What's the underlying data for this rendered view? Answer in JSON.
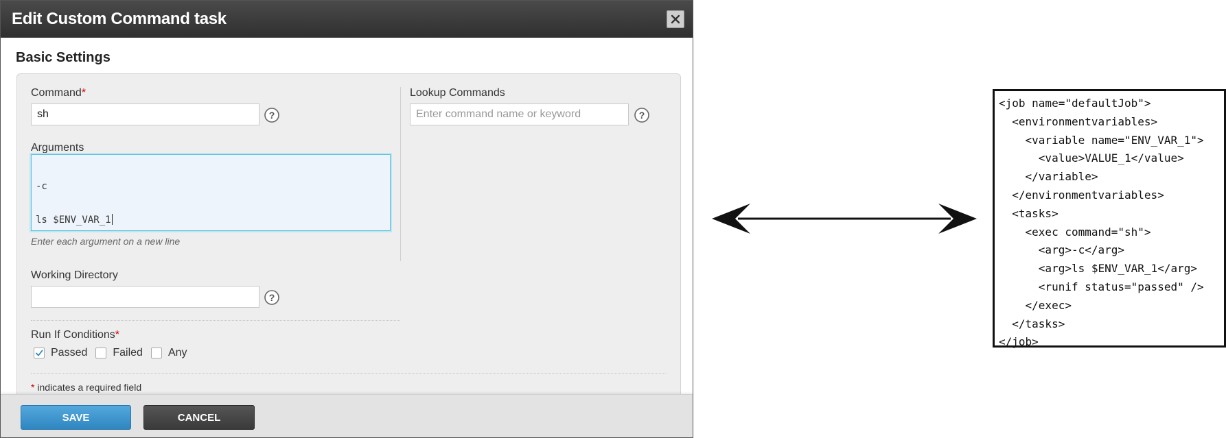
{
  "modal": {
    "title": "Edit Custom Command task",
    "section_title": "Basic Settings",
    "command": {
      "label": "Command",
      "required_mark": "*",
      "value": "sh"
    },
    "lookup": {
      "label": "Lookup Commands",
      "placeholder": "Enter command name or keyword"
    },
    "arguments": {
      "label": "Arguments",
      "lines": [
        "-c",
        "ls $ENV_VAR_1"
      ],
      "hint": "Enter each argument on a new line"
    },
    "working_directory": {
      "label": "Working Directory",
      "value": ""
    },
    "run_if": {
      "label": "Run If Conditions",
      "required_mark": "*",
      "options": [
        {
          "label": "Passed",
          "checked": true
        },
        {
          "label": "Failed",
          "checked": false
        },
        {
          "label": "Any",
          "checked": false
        }
      ]
    },
    "required_note": {
      "mark": "*",
      "text": " indicates a required field"
    },
    "buttons": {
      "save": "SAVE",
      "cancel": "CANCEL"
    }
  },
  "xml_lines": [
    "<job name=\"defaultJob\">",
    "  <environmentvariables>",
    "    <variable name=\"ENV_VAR_1\">",
    "      <value>VALUE_1</value>",
    "    </variable>",
    "  </environmentvariables>",
    "  <tasks>",
    "    <exec command=\"sh\">",
    "      <arg>-c</arg>",
    "      <arg>ls $ENV_VAR_1</arg>",
    "      <runif status=\"passed\" />",
    "    </exec>",
    "  </tasks>",
    "</job>"
  ],
  "colors": {
    "header_bg": "#3a3a3a",
    "accent_blue": "#2f86c0",
    "required_red": "#cc0000",
    "focus_border": "#5bc0de"
  }
}
